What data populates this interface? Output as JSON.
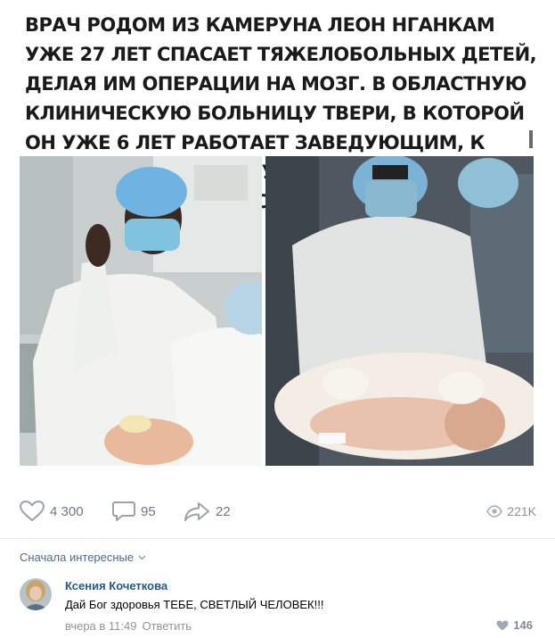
{
  "post": {
    "headline": "Врач родом из Камеруна Леон Нганкам уже 27 лет спасает тяжелобольных детей, делая им операции на мозг. В областную клиническую больницу Твери, в которой он уже 6 лет работает заведующим, к детскому нейрохирургу стремятся попасть со всей России.",
    "likes": "4 300",
    "comments": "95",
    "shares": "22",
    "views": "221K"
  },
  "comments_section": {
    "sort_label": "Сначала интересные",
    "items": [
      {
        "author": "Ксения Кочеткова",
        "text": "Дай Бог здоровья ТЕБЕ, СВЕТЛЫЙ ЧЕЛОВЕК!!!",
        "time": "вчера в 11:49",
        "reply_label": "Ответить",
        "likes": "146"
      }
    ]
  },
  "icons": {
    "like": "heart-icon",
    "comment": "comment-bubble-icon",
    "share": "share-arrow-icon",
    "views": "eye-icon",
    "sort": "chevron-down-icon"
  },
  "colors": {
    "link": "#2a5885",
    "icon": "#99a2ad",
    "muted": "#939393"
  }
}
